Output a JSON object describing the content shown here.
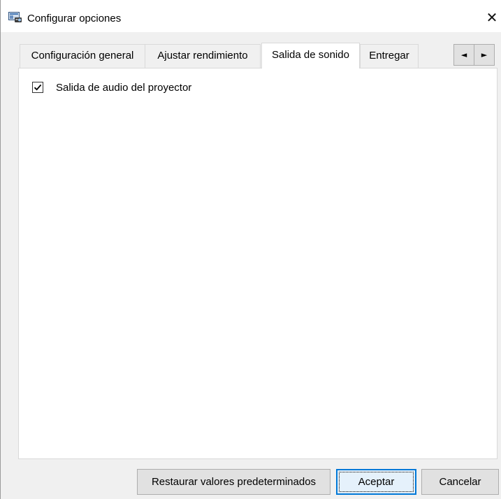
{
  "window": {
    "title": "Configurar opciones",
    "icon": "projector-settings-icon",
    "close_glyph": "✕"
  },
  "tabs": [
    {
      "label": "Configuración general",
      "active": false
    },
    {
      "label": "Ajustar rendimiento",
      "active": false
    },
    {
      "label": "Salida de sonido",
      "active": true
    },
    {
      "label": "Entregar",
      "active": false
    }
  ],
  "tab_scroll": {
    "left_glyph": "◄",
    "right_glyph": "►"
  },
  "options": {
    "audio_output": {
      "label": "Salida de audio del proyector",
      "checked": true
    }
  },
  "buttons": {
    "restore_defaults": "Restaurar valores predeterminados",
    "accept": "Aceptar",
    "cancel": "Cancelar"
  },
  "colors": {
    "accent": "#0078d7",
    "dialog_background": "#f0f0f0",
    "panel_background": "#ffffff"
  }
}
